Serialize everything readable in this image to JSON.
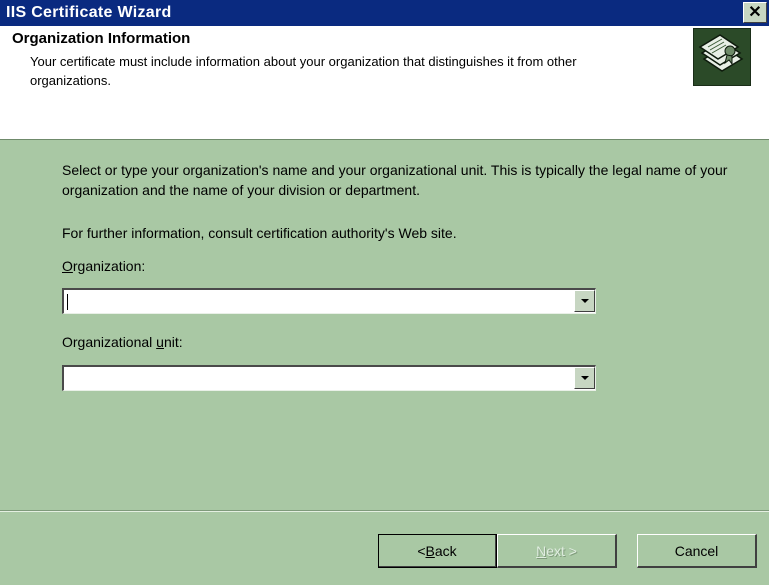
{
  "window": {
    "title": "IIS Certificate Wizard",
    "close_glyph": "✕"
  },
  "header": {
    "title": "Organization Information",
    "subtitle": "Your certificate must include information about your organization that distinguishes it from other organizations.",
    "icon": "certificate-wizard-icon"
  },
  "content": {
    "description": "Select or type your organization's name and your organizational unit. This is typically the legal name of your organization and the name of your division or department.",
    "info": "For further information, consult certification authority's Web site.",
    "organization": {
      "label_prefix": "",
      "label_mnemonic": "O",
      "label_suffix": "rganization:",
      "value": ""
    },
    "unit": {
      "label_prefix": "Organizational ",
      "label_mnemonic": "u",
      "label_suffix": "nit:",
      "value": ""
    }
  },
  "buttons": {
    "back_prefix": "< ",
    "back_mnemonic": "B",
    "back_suffix": "ack",
    "next_mnemonic": "N",
    "next_suffix": "ext >",
    "cancel": "Cancel"
  },
  "colors": {
    "face": "#a9c8a4",
    "title_bar": "#0a2a80"
  }
}
